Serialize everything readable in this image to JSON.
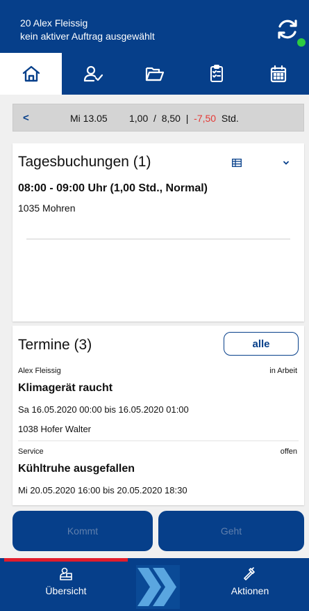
{
  "header": {
    "user": "20 Alex Fleissig",
    "status": "kein aktiver Auftrag ausgewählt",
    "sync_icon": "sync-icon",
    "online_color": "#2ecc40",
    "background": "#063f8a"
  },
  "nav": {
    "active": "home",
    "tabs": [
      "home-icon",
      "user-check-icon",
      "folder-icon",
      "clipboard-checklist-icon",
      "calendar-icon"
    ]
  },
  "datebar": {
    "back": "<",
    "date": "Mi 13.05",
    "worked": "1,00",
    "sep1": "/",
    "target": "8,50",
    "sep2": "|",
    "diff": "-7,50",
    "unit": "Std."
  },
  "bookings": {
    "title": "Tagesbuchungen (1)",
    "items": [
      {
        "time": "08:00 - 09:00 Uhr (1,00 Std., Normal)",
        "customer": "1035 Mohren"
      }
    ]
  },
  "appointments": {
    "title": "Termine (3)",
    "filter_label": "alle",
    "items": [
      {
        "assignee": "Alex Fleissig",
        "state": "in Arbeit",
        "subject": "Klimagerät raucht",
        "when": "Sa 16.05.2020 00:00 bis 16.05.2020 01:00",
        "customer": "1038  Hofer Walter"
      },
      {
        "assignee": "Service",
        "state": "offen",
        "subject": "Kühltruhe ausgefallen",
        "when": "Mi 20.05.2020 16:00 bis 20.05.2020 18:30"
      }
    ]
  },
  "actions": {
    "kommt": "Kommt",
    "geht": "Geht"
  },
  "bottom_nav": {
    "overview": "Übersicht",
    "actions": "Aktionen",
    "accent": "#e11d2c"
  }
}
